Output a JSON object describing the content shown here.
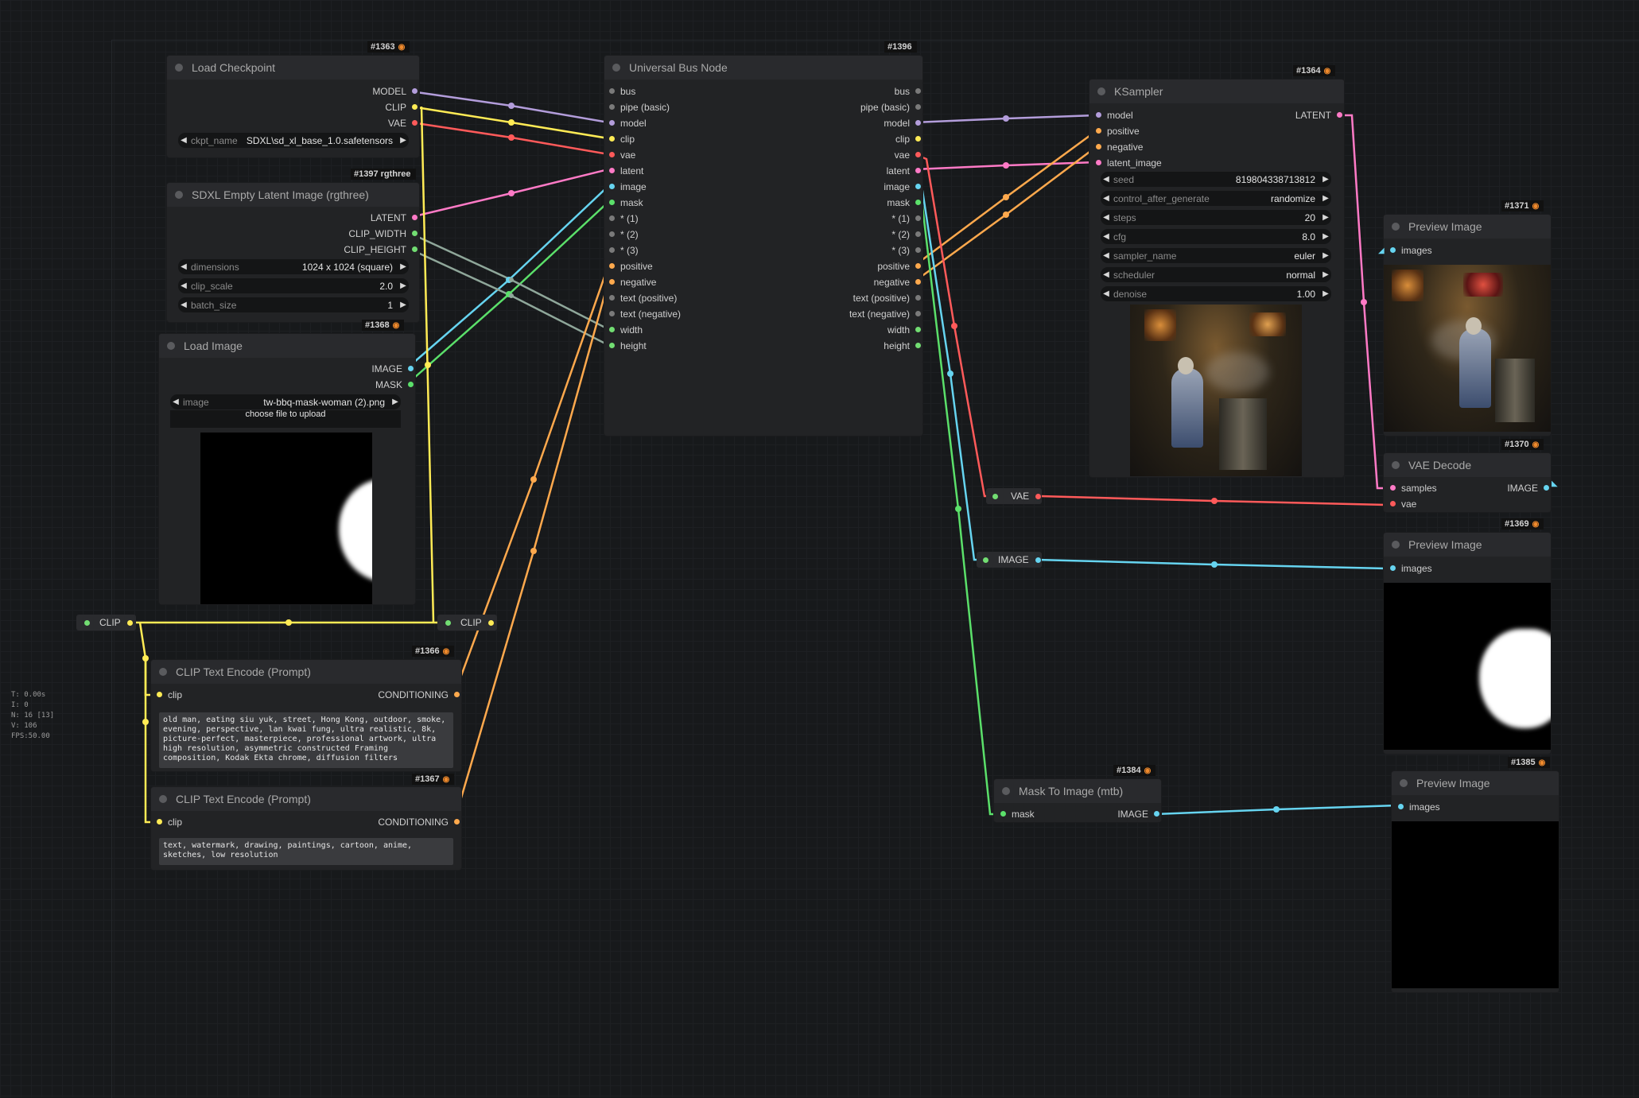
{
  "colors": {
    "model": "#b39ddb",
    "clip": "#ffeb55",
    "vae": "#ff5a5a",
    "latent": "#ff7ac6",
    "image": "#66d4f0",
    "mask": "#5be06a",
    "conditioning": "#ffa94d",
    "int": "#72dd72",
    "generic": "#7a7a7a"
  },
  "stats": [
    "T: 0.00s",
    "I: 0",
    "N: 16 [13]",
    "V: 106",
    "FPS:50.00"
  ],
  "nodes": {
    "load_checkpoint": {
      "id": "#1363",
      "title": "Load Checkpoint",
      "outputs": [
        "MODEL",
        "CLIP",
        "VAE"
      ],
      "widget": {
        "label": "ckpt_name",
        "value": "SDXL\\sd_xl_base_1.0.safetensors"
      }
    },
    "sdxl_empty_latent": {
      "id": "#1397 rgthree",
      "title": "SDXL Empty Latent Image (rgthree)",
      "outputs": [
        "LATENT",
        "CLIP_WIDTH",
        "CLIP_HEIGHT"
      ],
      "widgets": [
        {
          "label": "dimensions",
          "value": "1024 x 1024  (square)"
        },
        {
          "label": "clip_scale",
          "value": "2.0"
        },
        {
          "label": "batch_size",
          "value": "1"
        }
      ]
    },
    "load_image": {
      "id": "#1368",
      "title": "Load Image",
      "outputs": [
        "IMAGE",
        "MASK"
      ],
      "widget": {
        "label": "image",
        "value": "tw-bbq-mask-woman (2).png"
      },
      "upload_label": "choose file to upload"
    },
    "universal_bus": {
      "id": "#1396",
      "title": "Universal Bus Node",
      "inputs": [
        "bus",
        "pipe (basic)",
        "model",
        "clip",
        "vae",
        "latent",
        "image",
        "mask",
        "* (1)",
        "* (2)",
        "* (3)",
        "positive",
        "negative",
        "text (positive)",
        "text (negative)",
        "width",
        "height"
      ],
      "outputs": [
        "bus",
        "pipe (basic)",
        "model",
        "clip",
        "vae",
        "latent",
        "image",
        "mask",
        "* (1)",
        "* (2)",
        "* (3)",
        "positive",
        "negative",
        "text (positive)",
        "text (negative)",
        "width",
        "height"
      ]
    },
    "ksampler": {
      "id": "#1364",
      "title": "KSampler",
      "inputs": [
        "model",
        "positive",
        "negative",
        "latent_image"
      ],
      "outputs": [
        "LATENT"
      ],
      "widgets": [
        {
          "label": "seed",
          "value": "819804338713812"
        },
        {
          "label": "control_after_generate",
          "value": "randomize"
        },
        {
          "label": "steps",
          "value": "20"
        },
        {
          "label": "cfg",
          "value": "8.0"
        },
        {
          "label": "sampler_name",
          "value": "euler"
        },
        {
          "label": "scheduler",
          "value": "normal"
        },
        {
          "label": "denoise",
          "value": "1.00"
        }
      ]
    },
    "preview_1371": {
      "id": "#1371",
      "title": "Preview Image",
      "inputs": [
        "images"
      ]
    },
    "vae_decode": {
      "id": "#1370",
      "title": "VAE Decode",
      "inputs": [
        "samples",
        "vae"
      ],
      "outputs": [
        "IMAGE"
      ]
    },
    "preview_1369": {
      "id": "#1369",
      "title": "Preview Image",
      "inputs": [
        "images"
      ]
    },
    "mask_to_image": {
      "id": "#1384",
      "title": "Mask To Image (mtb)",
      "inputs": [
        "mask"
      ],
      "outputs": [
        "IMAGE"
      ]
    },
    "preview_1385": {
      "id": "#1385",
      "title": "Preview Image",
      "inputs": [
        "images"
      ]
    },
    "clip_text_pos": {
      "id": "#1366",
      "title": "CLIP Text Encode (Prompt)",
      "inputs": [
        "clip"
      ],
      "outputs": [
        "CONDITIONING"
      ],
      "text": "old man, eating siu yuk, street, Hong Kong, outdoor, smoke, evening, perspective, lan kwai fung, ultra realistic, 8k, picture-perfect, masterpiece, professional artwork, ultra high resolution, asymmetric constructed Framing composition, Kodak Ekta chrome, diffusion filters"
    },
    "clip_text_neg": {
      "id": "#1367",
      "title": "CLIP Text Encode (Prompt)",
      "inputs": [
        "clip"
      ],
      "outputs": [
        "CONDITIONING"
      ],
      "text": "text, watermark, drawing, paintings, cartoon, anime, sketches, low resolution"
    }
  },
  "reroutes": {
    "clip_left": "CLIP",
    "clip_right": "CLIP",
    "vae": "VAE",
    "image": "IMAGE"
  }
}
